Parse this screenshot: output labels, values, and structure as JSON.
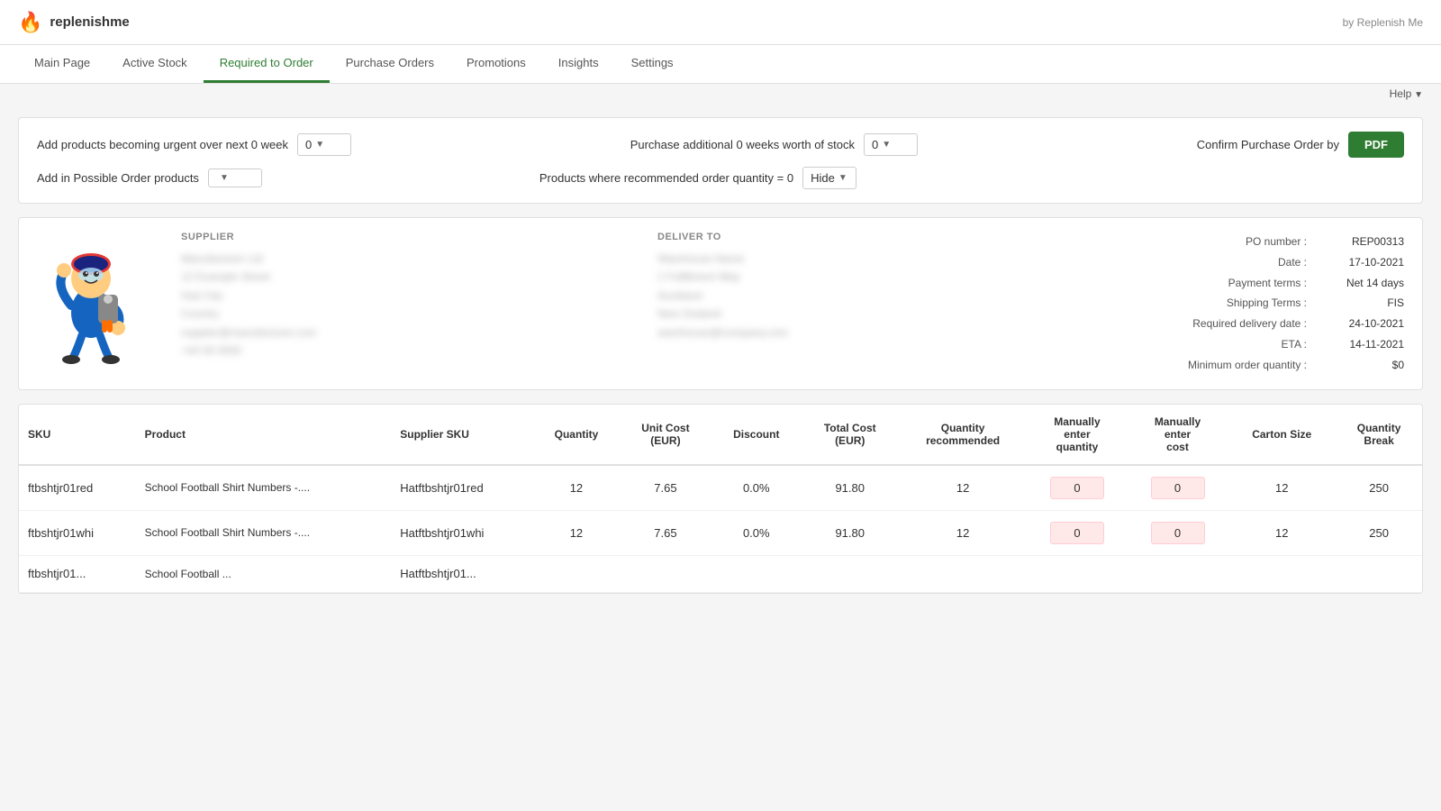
{
  "app": {
    "name": "replenishme",
    "byText": "by Replenish Me",
    "logoIcon": "🔥"
  },
  "nav": {
    "items": [
      {
        "id": "main-page",
        "label": "Main Page",
        "active": false
      },
      {
        "id": "active-stock",
        "label": "Active Stock",
        "active": false
      },
      {
        "id": "required-to-order",
        "label": "Required to Order",
        "active": true
      },
      {
        "id": "purchase-orders",
        "label": "Purchase Orders",
        "active": false
      },
      {
        "id": "promotions",
        "label": "Promotions",
        "active": false
      },
      {
        "id": "insights",
        "label": "Insights",
        "active": false
      },
      {
        "id": "settings",
        "label": "Settings",
        "active": false
      }
    ]
  },
  "help": {
    "label": "Help"
  },
  "controls": {
    "row1": {
      "left": {
        "label": "Add products becoming urgent over next 0 week",
        "value": "0"
      },
      "center": {
        "label": "Purchase additional 0 weeks worth of stock",
        "value": "0"
      },
      "right": {
        "label": "Confirm Purchase Order by",
        "buttonLabel": "PDF"
      }
    },
    "row2": {
      "left": {
        "label": "Add in Possible Order products",
        "value": ""
      },
      "center": {
        "label": "Products where recommended order quantity = 0",
        "value": "Hide"
      }
    }
  },
  "po": {
    "number_label": "PO number :",
    "number_value": "REP00313",
    "date_label": "Date :",
    "date_value": "17-10-2021",
    "payment_label": "Payment terms :",
    "payment_value": "Net 14 days",
    "shipping_label": "Shipping Terms :",
    "shipping_value": "FIS",
    "delivery_label": "Required delivery date :",
    "delivery_value": "24-10-2021",
    "eta_label": "ETA :",
    "eta_value": "14-11-2021",
    "moq_label": "Minimum order quantity :",
    "moq_value": "$0"
  },
  "supplier": {
    "sectionLabel": "SUPPLIER"
  },
  "deliverTo": {
    "sectionLabel": "DELIVER TO"
  },
  "table": {
    "columns": [
      {
        "id": "sku",
        "label": "SKU"
      },
      {
        "id": "product",
        "label": "Product"
      },
      {
        "id": "supplier-sku",
        "label": "Supplier SKU"
      },
      {
        "id": "quantity",
        "label": "Quantity"
      },
      {
        "id": "unit-cost",
        "label": "Unit Cost (EUR)"
      },
      {
        "id": "discount",
        "label": "Discount"
      },
      {
        "id": "total-cost",
        "label": "Total Cost (EUR)"
      },
      {
        "id": "qty-recommended",
        "label": "Quantity recommended"
      },
      {
        "id": "manually-enter-qty",
        "label": "Manually enter quantity"
      },
      {
        "id": "manually-enter-cost",
        "label": "Manually enter cost"
      },
      {
        "id": "carton-size",
        "label": "Carton Size"
      },
      {
        "id": "qty-break",
        "label": "Quantity Break"
      }
    ],
    "rows": [
      {
        "sku": "ftbshtjr01red",
        "product": "School Football Shirt Numbers -....",
        "supplierSku": "Hatftbshtjr01red",
        "quantity": "12",
        "unitCost": "7.65",
        "discount": "0.0%",
        "totalCost": "91.80",
        "qtyRecommended": "12",
        "manualEnterQty": "0",
        "manualEnterCost": "0",
        "cartonSize": "12",
        "qtyBreak": "250"
      },
      {
        "sku": "ftbshtjr01whi",
        "product": "School Football Shirt Numbers -....",
        "supplierSku": "Hatftbshtjr01whi",
        "quantity": "12",
        "unitCost": "7.65",
        "discount": "0.0%",
        "totalCost": "91.80",
        "qtyRecommended": "12",
        "manualEnterQty": "0",
        "manualEnterCost": "0",
        "cartonSize": "12",
        "qtyBreak": "250"
      },
      {
        "sku": "ftbshtjr01...",
        "product": "School Football ...",
        "supplierSku": "Hatftbshtjr01...",
        "quantity": "",
        "unitCost": "",
        "discount": "",
        "totalCost": "",
        "qtyRecommended": "",
        "manualEnterQty": "",
        "manualEnterCost": "",
        "cartonSize": "",
        "qtyBreak": ""
      }
    ]
  }
}
